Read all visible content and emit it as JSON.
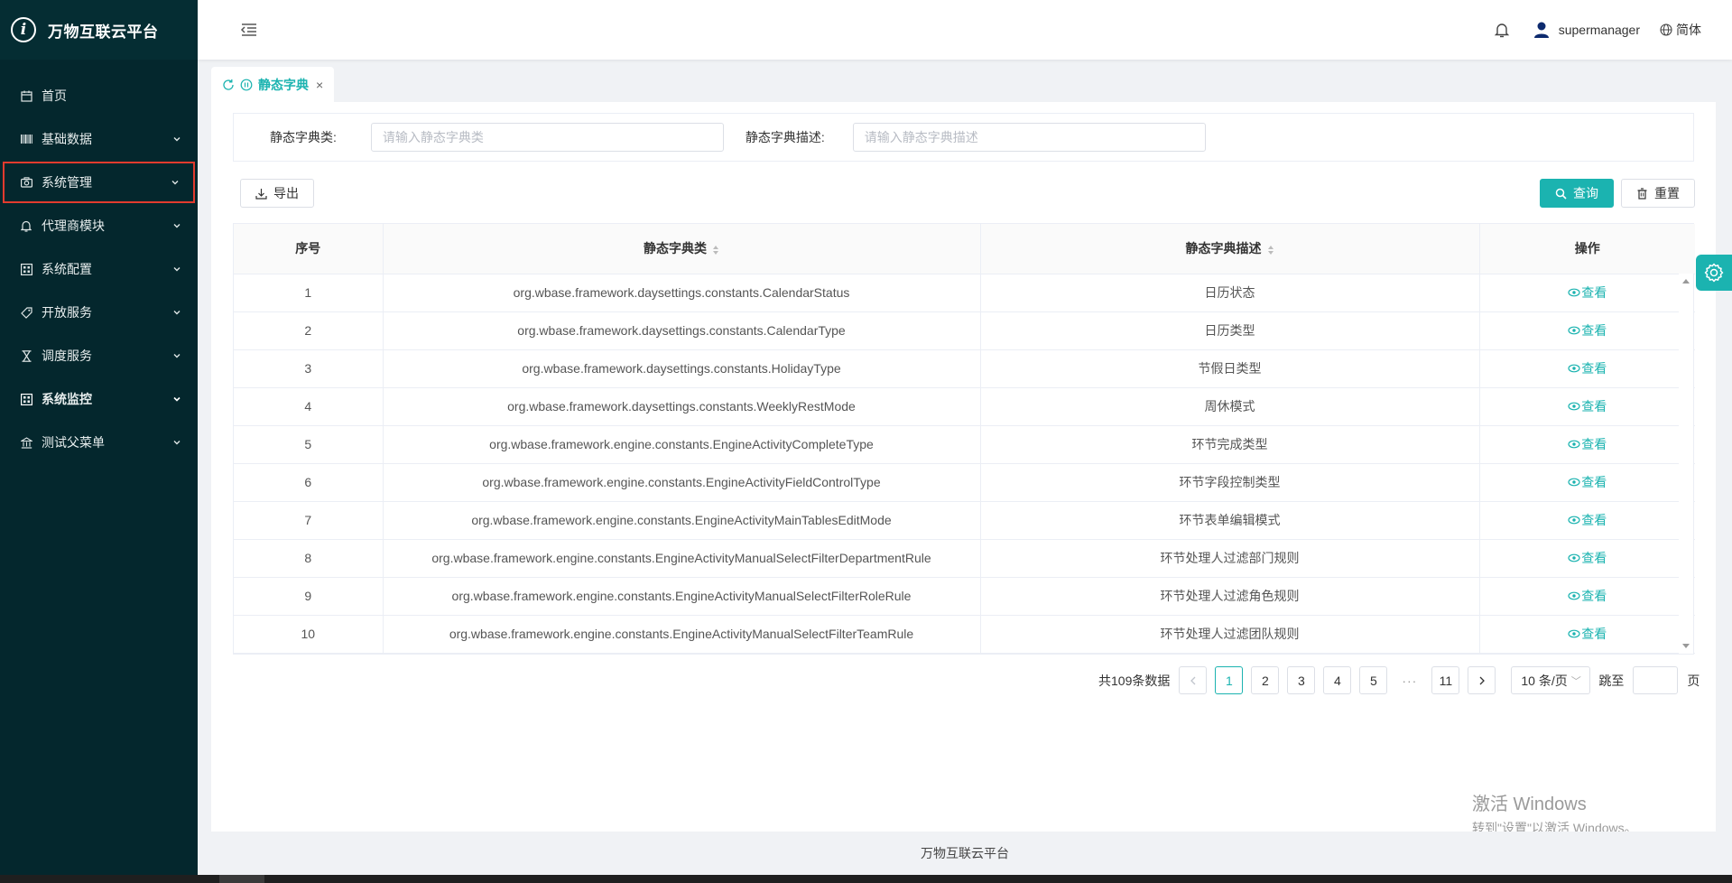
{
  "app": {
    "title": "万物互联云平台",
    "logo_letter": "i"
  },
  "sidebar": {
    "items": [
      {
        "label": "首页",
        "icon": "calendar-icon",
        "has_arrow": false
      },
      {
        "label": "基础数据",
        "icon": "barcode-icon",
        "has_arrow": true
      },
      {
        "label": "系统管理",
        "icon": "camera-icon",
        "has_arrow": true,
        "highlighted": true
      },
      {
        "label": "代理商模块",
        "icon": "bell-icon",
        "has_arrow": true
      },
      {
        "label": "系统配置",
        "icon": "grid-icon",
        "has_arrow": true
      },
      {
        "label": "开放服务",
        "icon": "tag-icon",
        "has_arrow": true
      },
      {
        "label": "调度服务",
        "icon": "hourglass-icon",
        "has_arrow": true
      },
      {
        "label": "系统监控",
        "icon": "grid-icon",
        "has_arrow": true,
        "bold": true
      },
      {
        "label": "测试父菜单",
        "icon": "bank-icon",
        "has_arrow": true
      }
    ]
  },
  "header": {
    "username": "supermanager",
    "language": "简体"
  },
  "tabs": [
    {
      "label": "静态字典",
      "active": true
    }
  ],
  "filters": {
    "class_label": "静态字典类:",
    "class_placeholder": "请输入静态字典类",
    "desc_label": "静态字典描述:",
    "desc_placeholder": "请输入静态字典描述"
  },
  "toolbar": {
    "export_label": "导出",
    "query_label": "查询",
    "reset_label": "重置"
  },
  "table": {
    "columns": [
      "序号",
      "静态字典类",
      "静态字典描述",
      "操作"
    ],
    "action_label": "查看",
    "rows": [
      {
        "index": "1",
        "class": "org.wbase.framework.daysettings.constants.CalendarStatus",
        "desc": "日历状态"
      },
      {
        "index": "2",
        "class": "org.wbase.framework.daysettings.constants.CalendarType",
        "desc": "日历类型"
      },
      {
        "index": "3",
        "class": "org.wbase.framework.daysettings.constants.HolidayType",
        "desc": "节假日类型"
      },
      {
        "index": "4",
        "class": "org.wbase.framework.daysettings.constants.WeeklyRestMode",
        "desc": "周休模式"
      },
      {
        "index": "5",
        "class": "org.wbase.framework.engine.constants.EngineActivityCompleteType",
        "desc": "环节完成类型"
      },
      {
        "index": "6",
        "class": "org.wbase.framework.engine.constants.EngineActivityFieldControlType",
        "desc": "环节字段控制类型"
      },
      {
        "index": "7",
        "class": "org.wbase.framework.engine.constants.EngineActivityMainTablesEditMode",
        "desc": "环节表单编辑模式"
      },
      {
        "index": "8",
        "class": "org.wbase.framework.engine.constants.EngineActivityManualSelectFilterDepartmentRule",
        "desc": "环节处理人过滤部门规则"
      },
      {
        "index": "9",
        "class": "org.wbase.framework.engine.constants.EngineActivityManualSelectFilterRoleRule",
        "desc": "环节处理人过滤角色规则"
      },
      {
        "index": "10",
        "class": "org.wbase.framework.engine.constants.EngineActivityManualSelectFilterTeamRule",
        "desc": "环节处理人过滤团队规则"
      }
    ]
  },
  "pagination": {
    "total_text": "共109条数据",
    "pages": [
      "1",
      "2",
      "3",
      "4",
      "5"
    ],
    "ellipsis": "···",
    "last_page": "11",
    "current": "1",
    "page_size": "10 条/页",
    "jump_label": "跳至",
    "page_unit": "页"
  },
  "footer": {
    "text": "万物互联云平台"
  },
  "watermark": {
    "line1": "激活 Windows",
    "line2": "转到\"设置\"以激活 Windows。"
  },
  "colors": {
    "accent": "#1bb3b0",
    "sidebar_bg": "#04272d",
    "highlight_border": "#e23b2e"
  }
}
